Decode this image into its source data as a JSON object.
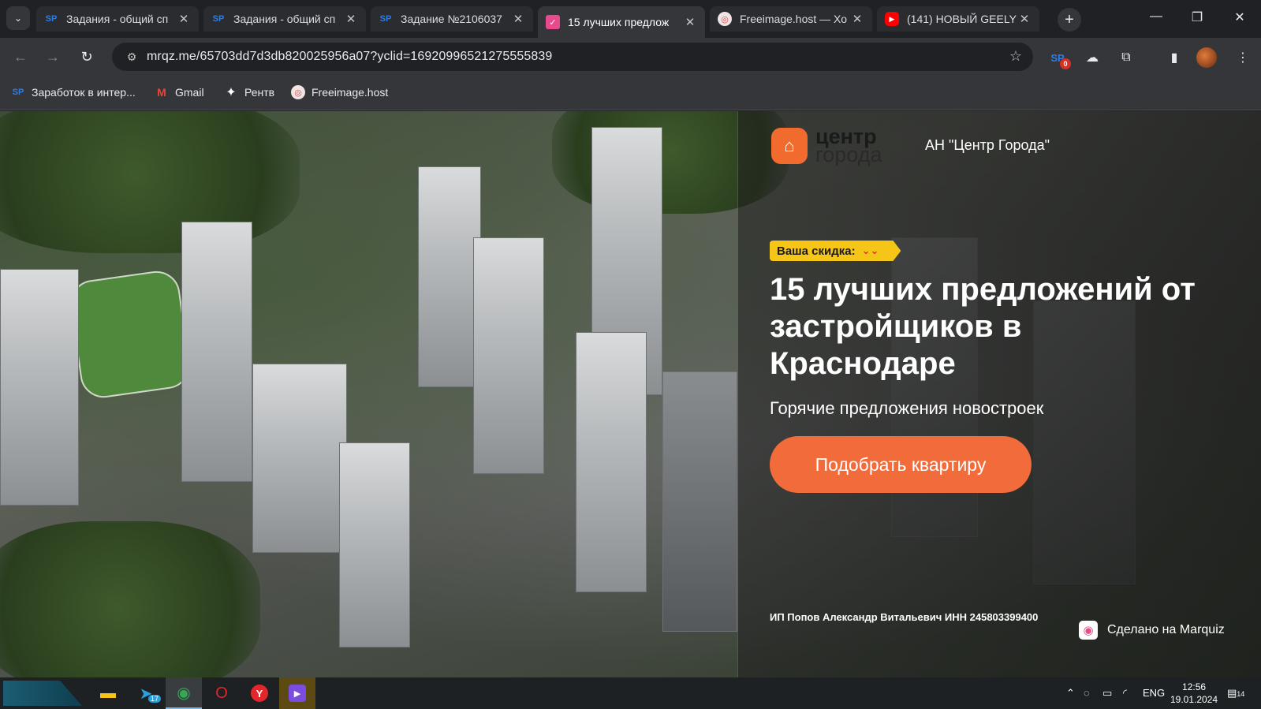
{
  "browser": {
    "tabs": [
      {
        "title": "Задания - общий сп",
        "favicon": "SP"
      },
      {
        "title": "Задания - общий сп",
        "favicon": "SP"
      },
      {
        "title": "Задание №2106037",
        "favicon": "SP"
      },
      {
        "title": "15 лучших предлож",
        "favicon": "check"
      },
      {
        "title": "Freeimage.host — Хо",
        "favicon": "freeimage"
      },
      {
        "title": "(141) НОВЫЙ GEELY",
        "favicon": "youtube"
      }
    ],
    "active_tab_index": 3,
    "url": "mrqz.me/65703dd7d3db820025956a07?yclid=16920996521275555839",
    "extension_badge": "0",
    "bookmarks": [
      {
        "label": "Заработок в интер...",
        "icon": "SP"
      },
      {
        "label": "Gmail",
        "icon": "gmail-icon"
      },
      {
        "label": "Рентв",
        "icon": "rentv-icon"
      },
      {
        "label": "Freeimage.host",
        "icon": "freeimage-icon"
      }
    ]
  },
  "page": {
    "logo": {
      "line1": "центр",
      "line2": "города"
    },
    "agency_name": "АН \"Центр Города\"",
    "discount_label": "Ваша скидка:",
    "headline": "15 лучших предложений от застройщиков в Краснодаре",
    "subheadline": "Горячие предложения новостроек",
    "cta_label": "Подобрать квартиру",
    "legal_text": "ИП Попов Александр Витальевич ИНН 245803399400",
    "made_with": "Сделано на Marquiz",
    "colors": {
      "accent": "#f26b3a",
      "badge": "#f5c518"
    }
  },
  "taskbar": {
    "telegram_badge": "17",
    "language": "ENG",
    "time": "12:56",
    "date": "19.01.2024",
    "notifications": "14"
  }
}
